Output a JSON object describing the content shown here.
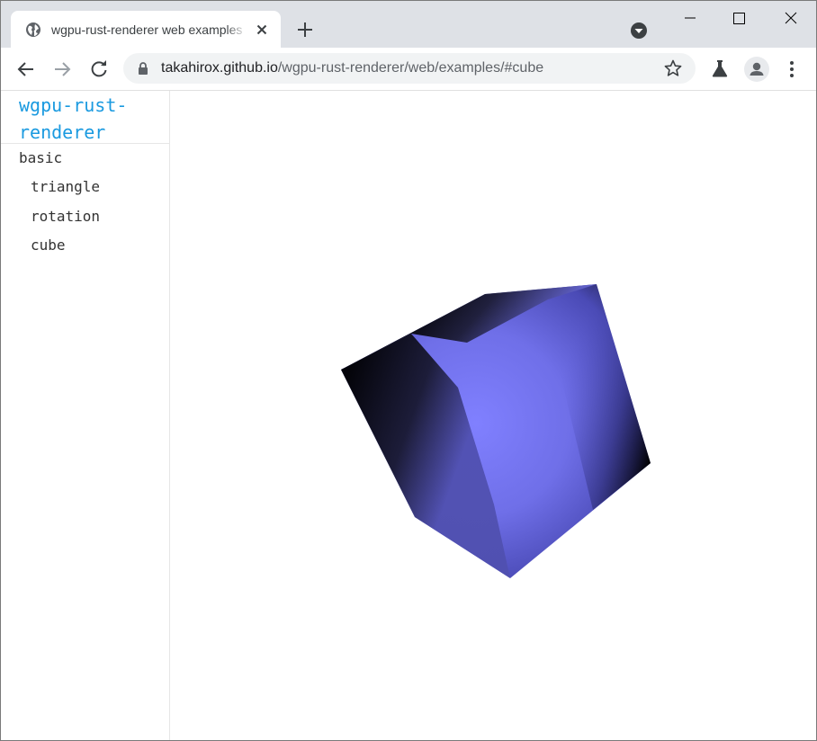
{
  "browser": {
    "tab": {
      "title": "wgpu-rust-renderer web examples",
      "favicon": "globe-icon"
    },
    "address_bar": {
      "host": "takahirox.github.io",
      "path": "/wgpu-rust-renderer/web/examples/#cube"
    },
    "colors": {
      "tabstrip": "#dee1e6",
      "omnibox": "#f1f3f4"
    }
  },
  "sidebar": {
    "brand_line1": "wgpu-rust-",
    "brand_line2": "renderer",
    "category": "basic",
    "items": [
      {
        "label": "triangle"
      },
      {
        "label": "rotation"
      },
      {
        "label": "cube"
      }
    ],
    "colors": {
      "brand": "#1a9ae0",
      "text": "#333333"
    }
  },
  "canvas": {
    "object": "cube",
    "colors": {
      "highlight": "#8080ff",
      "mid": "#5a5ad0",
      "shadow": "#000000"
    }
  }
}
